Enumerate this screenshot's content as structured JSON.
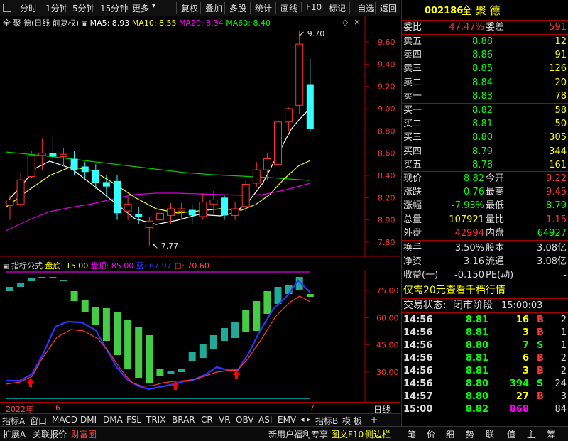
{
  "toolbar": {
    "items": [
      "分时",
      "1分钟",
      "5分钟",
      "15分钟",
      "更多",
      "复权",
      "叠加",
      "多股",
      "统计",
      "画线",
      "F10",
      "标记",
      "-自选",
      "返回"
    ]
  },
  "chart_info": {
    "title": "全 聚 德(日线 前复权)",
    "ma5": "MA5: 8.93",
    "ma10": "MA10: 8.55",
    "ma20": "MA20: 8.34",
    "ma60": "MA60: 8.40"
  },
  "price_axis": [
    "9.60",
    "9.40",
    "9.20",
    "9.00",
    "8.80",
    "8.60",
    "8.40",
    "8.20",
    "8.00",
    "7.80"
  ],
  "high_label": "9.70",
  "low_label": "7.77",
  "indicator_info": {
    "name": "指标公式",
    "pandi": "盘底: 15.00",
    "panding": "盘顶: 85.00",
    "lan": "蓝: 67.97",
    "bai": "白: 70.60"
  },
  "indicator_axis": [
    "75.00",
    "60.00",
    "45.00",
    "30.00"
  ],
  "date_axis": {
    "year": "2022年",
    "m6": "6",
    "m7": "7",
    "period": "日线"
  },
  "indicator_tabs": [
    "指标A",
    "窗口",
    "MACD",
    "DMI",
    "DMA",
    "FSL",
    "TRIX",
    "BRAR",
    "CR",
    "VR",
    "OBV",
    "ASI",
    "EMV"
  ],
  "indicator_tabs_right": [
    "指标B",
    "模 板",
    "+",
    "-"
  ],
  "bottom_bar_left": [
    "扩展A",
    "关联报价",
    "财富圈"
  ],
  "bottom_bar_mid": [
    "新用户福利专享",
    "图文F10",
    "侧边栏"
  ],
  "bottom_bar_right": [
    "笔",
    "价",
    "细",
    "势",
    "联",
    "值",
    "主",
    "筹"
  ],
  "quote": {
    "code": "002186",
    "name": "全 聚 德",
    "weibi_label": "委比",
    "weibi": "47.47%",
    "weicha_label": "委差",
    "weicha": "591",
    "sell": [
      {
        "label": "卖五",
        "price": "8.88",
        "vol": "12"
      },
      {
        "label": "卖四",
        "price": "8.86",
        "vol": "91"
      },
      {
        "label": "卖三",
        "price": "8.85",
        "vol": "126"
      },
      {
        "label": "卖二",
        "price": "8.84",
        "vol": "20"
      },
      {
        "label": "卖一",
        "price": "8.83",
        "vol": "78"
      }
    ],
    "buy": [
      {
        "label": "买一",
        "price": "8.82",
        "vol": "58"
      },
      {
        "label": "买二",
        "price": "8.81",
        "vol": "50"
      },
      {
        "label": "买三",
        "price": "8.80",
        "vol": "305"
      },
      {
        "label": "买四",
        "price": "8.79",
        "vol": "344"
      },
      {
        "label": "买五",
        "price": "8.78",
        "vol": "161"
      }
    ],
    "stats": [
      {
        "l1": "现价",
        "v1": "8.82",
        "l2": "今开",
        "v2": "9.22"
      },
      {
        "l1": "涨跌",
        "v1": "-0.76",
        "l2": "最高",
        "v2": "9.45"
      },
      {
        "l1": "涨幅",
        "v1": "-7.93%",
        "l2": "最低",
        "v2": "8.79"
      },
      {
        "l1": "总量",
        "v1": "107921",
        "l2": "量比",
        "v2": "1.15"
      },
      {
        "l1": "外盘",
        "v1": "42994",
        "l2": "内盘",
        "v2": "64927"
      }
    ],
    "fund": [
      {
        "l1": "换手",
        "v1": "3.50%",
        "l2": "股本",
        "v2": "3.08亿"
      },
      {
        "l1": "净资",
        "v1": "3.16",
        "l2": "流通",
        "v2": "3.08亿"
      },
      {
        "l1": "收益(一)",
        "v1": "-0.150",
        "l2": "PE(动)",
        "v2": "-"
      }
    ],
    "promo": "仅需20元查看千档行情",
    "status_label": "交易状态:",
    "status_value": "闭市阶段",
    "status_time": "15:00:03",
    "ticks": [
      {
        "t": "14:56",
        "p": "8.81",
        "v": "16",
        "d": "B",
        "n": "2"
      },
      {
        "t": "14:56",
        "p": "8.81",
        "v": "3",
        "d": "B",
        "n": "1"
      },
      {
        "t": "14:56",
        "p": "8.80",
        "v": "7",
        "d": "S",
        "n": "1"
      },
      {
        "t": "14:56",
        "p": "8.81",
        "v": "6",
        "d": "B",
        "n": "2"
      },
      {
        "t": "14:56",
        "p": "8.81",
        "v": "3",
        "d": "B",
        "n": "2"
      },
      {
        "t": "14:56",
        "p": "8.80",
        "v": "394",
        "d": "S",
        "n": "24"
      },
      {
        "t": "14:57",
        "p": "8.80",
        "v": "27",
        "d": "B",
        "n": "3"
      },
      {
        "t": "15:00",
        "p": "8.82",
        "v": "868",
        "d": "",
        "n": "84"
      }
    ]
  },
  "chart_data": {
    "type": "candlestick",
    "ylim": [
      7.7,
      9.78
    ],
    "candles": [
      {
        "o": 8.13,
        "c": 8.18,
        "h": 8.22,
        "l": 8.0
      },
      {
        "o": 8.14,
        "c": 8.36,
        "h": 8.42,
        "l": 8.12
      },
      {
        "o": 8.39,
        "c": 8.58,
        "h": 8.62,
        "l": 8.38
      },
      {
        "o": 8.58,
        "c": 8.6,
        "h": 8.73,
        "l": 8.45
      },
      {
        "o": 8.6,
        "c": 8.57,
        "h": 8.76,
        "l": 8.5
      },
      {
        "o": 8.57,
        "c": 8.59,
        "h": 8.65,
        "l": 8.48
      },
      {
        "o": 8.55,
        "c": 8.45,
        "h": 8.62,
        "l": 8.4
      },
      {
        "o": 8.48,
        "c": 8.43,
        "h": 8.52,
        "l": 8.38
      },
      {
        "o": 8.45,
        "c": 8.33,
        "h": 8.5,
        "l": 8.28
      },
      {
        "o": 8.34,
        "c": 8.3,
        "h": 8.4,
        "l": 8.2
      },
      {
        "o": 8.35,
        "c": 8.06,
        "h": 8.4,
        "l": 8.0
      },
      {
        "o": 8.08,
        "c": 8.14,
        "h": 8.2,
        "l": 8.0
      },
      {
        "o": 8.05,
        "c": 8.03,
        "h": 8.12,
        "l": 7.96
      },
      {
        "o": 7.93,
        "c": 7.99,
        "h": 8.03,
        "l": 7.77
      },
      {
        "o": 8.0,
        "c": 8.06,
        "h": 8.12,
        "l": 7.96
      },
      {
        "o": 8.04,
        "c": 8.1,
        "h": 8.15,
        "l": 7.96
      },
      {
        "o": 8.08,
        "c": 8.1,
        "h": 8.15,
        "l": 8.0
      },
      {
        "o": 8.09,
        "c": 8.04,
        "h": 8.14,
        "l": 7.96
      },
      {
        "o": 8.03,
        "c": 8.16,
        "h": 8.24,
        "l": 8.0
      },
      {
        "o": 8.14,
        "c": 8.18,
        "h": 8.26,
        "l": 8.05
      },
      {
        "o": 8.2,
        "c": 8.04,
        "h": 8.22,
        "l": 8.0
      },
      {
        "o": 8.04,
        "c": 8.1,
        "h": 8.16,
        "l": 8.0
      },
      {
        "o": 8.12,
        "c": 8.32,
        "h": 8.36,
        "l": 8.08
      },
      {
        "o": 8.33,
        "c": 8.45,
        "h": 8.52,
        "l": 8.3
      },
      {
        "o": 8.45,
        "c": 8.55,
        "h": 8.6,
        "l": 8.36
      },
      {
        "o": 8.5,
        "c": 8.88,
        "h": 8.95,
        "l": 8.48
      },
      {
        "o": 8.88,
        "c": 9.0,
        "h": 9.01,
        "l": 8.8
      },
      {
        "o": 9.03,
        "c": 9.58,
        "h": 9.7,
        "l": 8.95
      },
      {
        "o": 9.22,
        "c": 8.82,
        "h": 9.45,
        "l": 8.79
      }
    ]
  }
}
